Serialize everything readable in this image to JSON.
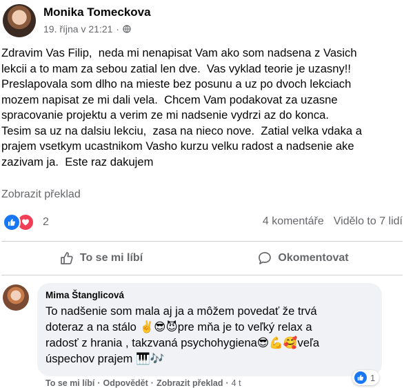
{
  "post": {
    "author": "Monika Tomeckova",
    "timestamp": "19. října v 21:21",
    "separator": "·",
    "audience_icon": "globe-icon",
    "text": "Zdravim Vas Filip,  neda mi nenapisat Vam ako som nadsena z Vasich\nlekcii a to mam za sebou zatial len dve.  Vas vyklad teorie je uzasny!!\nPreslapovala som dlho na mieste bez posunu a uz po dvoch lekciach\nmozem napisat ze mi dali vela.  Chcem Vam podakovat za uzasne\nspracovanie projektu a verim ze mi nadsenie vydrzi az do konca.\nTesim sa uz na dalsiu lekciu,  zasa na nieco nove.  Zatial velka vdaka a\nprajem vsetkym ucastnikom Vasho kurzu velku radost a nadsenie ake\nzazivam ja.  Este raz dakujem",
    "translate_label": "Zobrazit překlad",
    "reactions_count": "2",
    "comments_count": "4 komentáře",
    "views": "Viděl­o to 7 lidí",
    "like_label": "To se mi líbí",
    "comment_label": "Okomentovat"
  },
  "comment": {
    "author": "Mima Štanglicová",
    "text": "To nadšenie som mala aj ja a môžem povedať že trvá\ndoteraz a na stálo ✌️😎😈pre mňa je to veľký relax a\nradosť z hrania , takzvaná psychohygiena😎💪🥰veľa\núspechov prajem 🎹🎶",
    "like_count": "1",
    "action_like": "To se mi líbí",
    "action_reply": "Odpovědět",
    "action_translate": "Zobrazit překlad",
    "time": "4 t"
  },
  "colors": {
    "like_blue": "#1877f2",
    "love_red": "#f33e58",
    "secondary_text": "#65676b",
    "bubble_bg": "#f0f2f5"
  }
}
